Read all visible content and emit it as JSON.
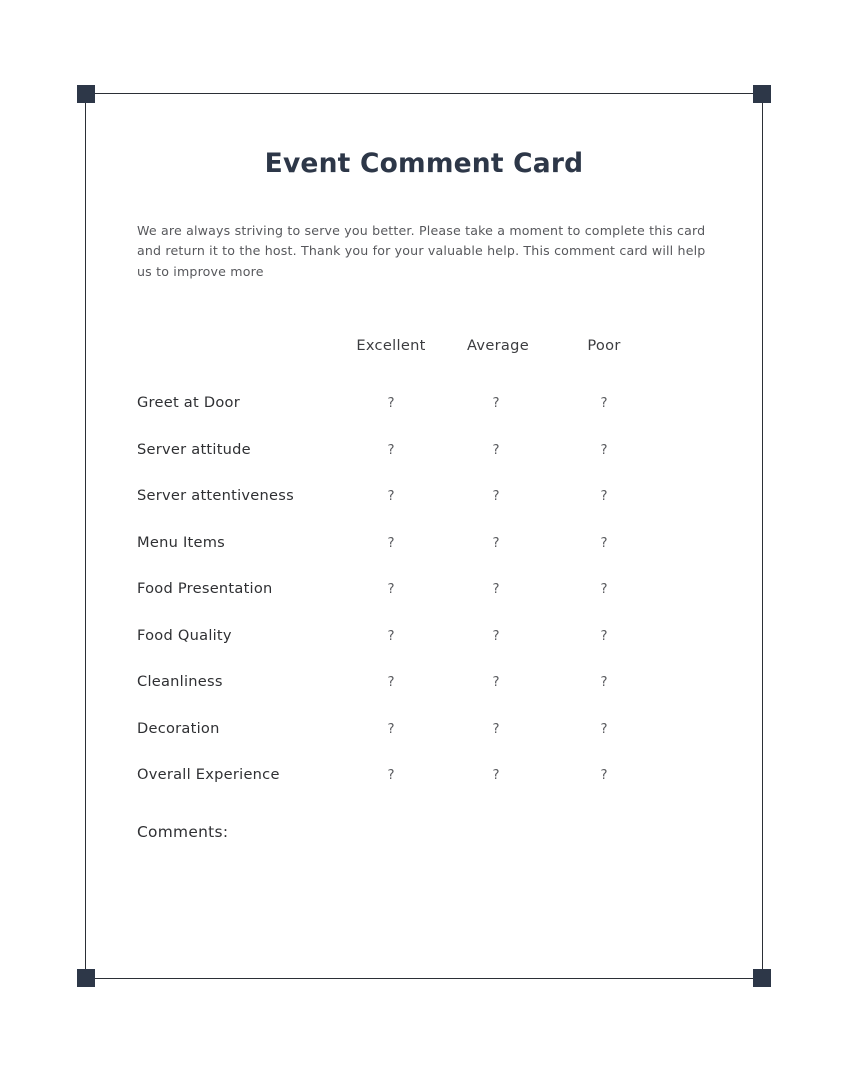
{
  "document": {
    "title": "Event Comment Card",
    "intro_paragraph": "We are always striving to serve you better. Please take a moment to complete this card and return it to the host. Thank you for your valuable help. This comment card will help us to improve more",
    "comments_label": "Comments:"
  },
  "rating_table": {
    "columns": [
      "Excellent",
      "Average",
      "Poor"
    ],
    "mark": "?",
    "rows": [
      {
        "label": "Greet at Door",
        "marks": [
          "?",
          "?",
          "?"
        ]
      },
      {
        "label": "Server attitude",
        "marks": [
          "?",
          "?",
          "?"
        ]
      },
      {
        "label": "Server attentiveness",
        "marks": [
          "?",
          "?",
          "?"
        ]
      },
      {
        "label": "Menu Items",
        "marks": [
          "?",
          "?",
          "?"
        ]
      },
      {
        "label": "Food Presentation",
        "marks": [
          "?",
          "?",
          "?"
        ]
      },
      {
        "label": "Food Quality",
        "marks": [
          "?",
          "?",
          "?"
        ]
      },
      {
        "label": "Cleanliness",
        "marks": [
          "?",
          "?",
          "?"
        ]
      },
      {
        "label": "Decoration",
        "marks": [
          "?",
          "?",
          "?"
        ]
      },
      {
        "label": "Overall Experience",
        "marks": [
          "?",
          "?",
          "?"
        ]
      }
    ]
  },
  "theme": {
    "page_background": "#ffffff",
    "frame_line_color": "#2b2f36",
    "corner_marker_color": "#2d3748",
    "title_color": "#2d3748",
    "body_text_color": "#57585c",
    "label_text_color": "#2f3033"
  }
}
